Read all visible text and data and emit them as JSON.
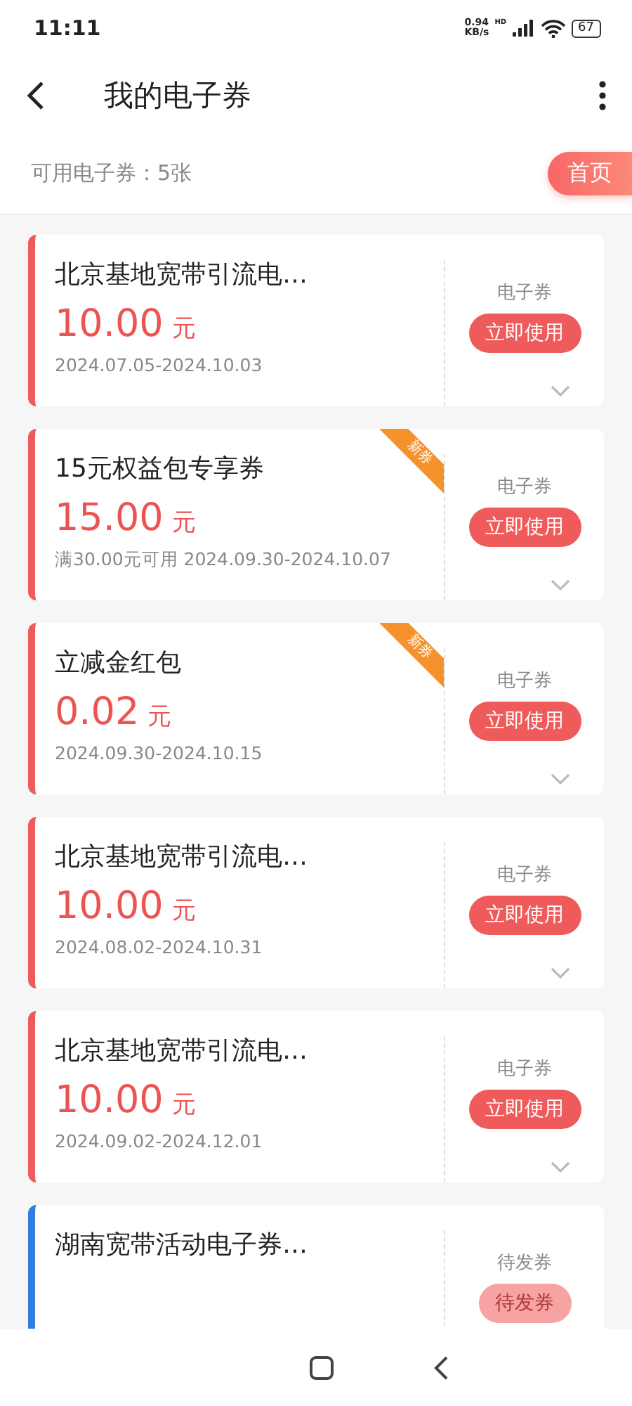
{
  "status_bar": {
    "time": "11:11",
    "speed": "0.94",
    "speed_unit": "KB/s",
    "network": "HD",
    "battery": "67"
  },
  "header": {
    "title": "我的电子券"
  },
  "summary": {
    "text": "可用电子券：5张",
    "home_button": "首页"
  },
  "coupons": [
    {
      "title": "北京基地宽带引流电…",
      "price": "10.00",
      "unit": "元",
      "note": "2024.07.05-2024.10.03",
      "type_label": "电子券",
      "action": "立即使用",
      "is_new": false,
      "kind": "available"
    },
    {
      "title": "15元权益包专享券",
      "price": "15.00",
      "unit": "元",
      "note": "满30.00元可用 2024.09.30-2024.10.07",
      "type_label": "电子券",
      "action": "立即使用",
      "is_new": true,
      "ribbon": "新券",
      "kind": "available"
    },
    {
      "title": "立减金红包",
      "price": "0.02",
      "unit": "元",
      "note": "2024.09.30-2024.10.15",
      "type_label": "电子券",
      "action": "立即使用",
      "is_new": true,
      "ribbon": "新券",
      "kind": "available"
    },
    {
      "title": "北京基地宽带引流电…",
      "price": "10.00",
      "unit": "元",
      "note": "2024.08.02-2024.10.31",
      "type_label": "电子券",
      "action": "立即使用",
      "is_new": false,
      "kind": "available"
    },
    {
      "title": "北京基地宽带引流电…",
      "price": "10.00",
      "unit": "元",
      "note": "2024.09.02-2024.12.01",
      "type_label": "电子券",
      "action": "立即使用",
      "is_new": false,
      "kind": "available"
    },
    {
      "title": "湖南宽带活动电子券…",
      "type_label": "待发券",
      "action": "待发券",
      "is_new": false,
      "kind": "pending"
    }
  ]
}
